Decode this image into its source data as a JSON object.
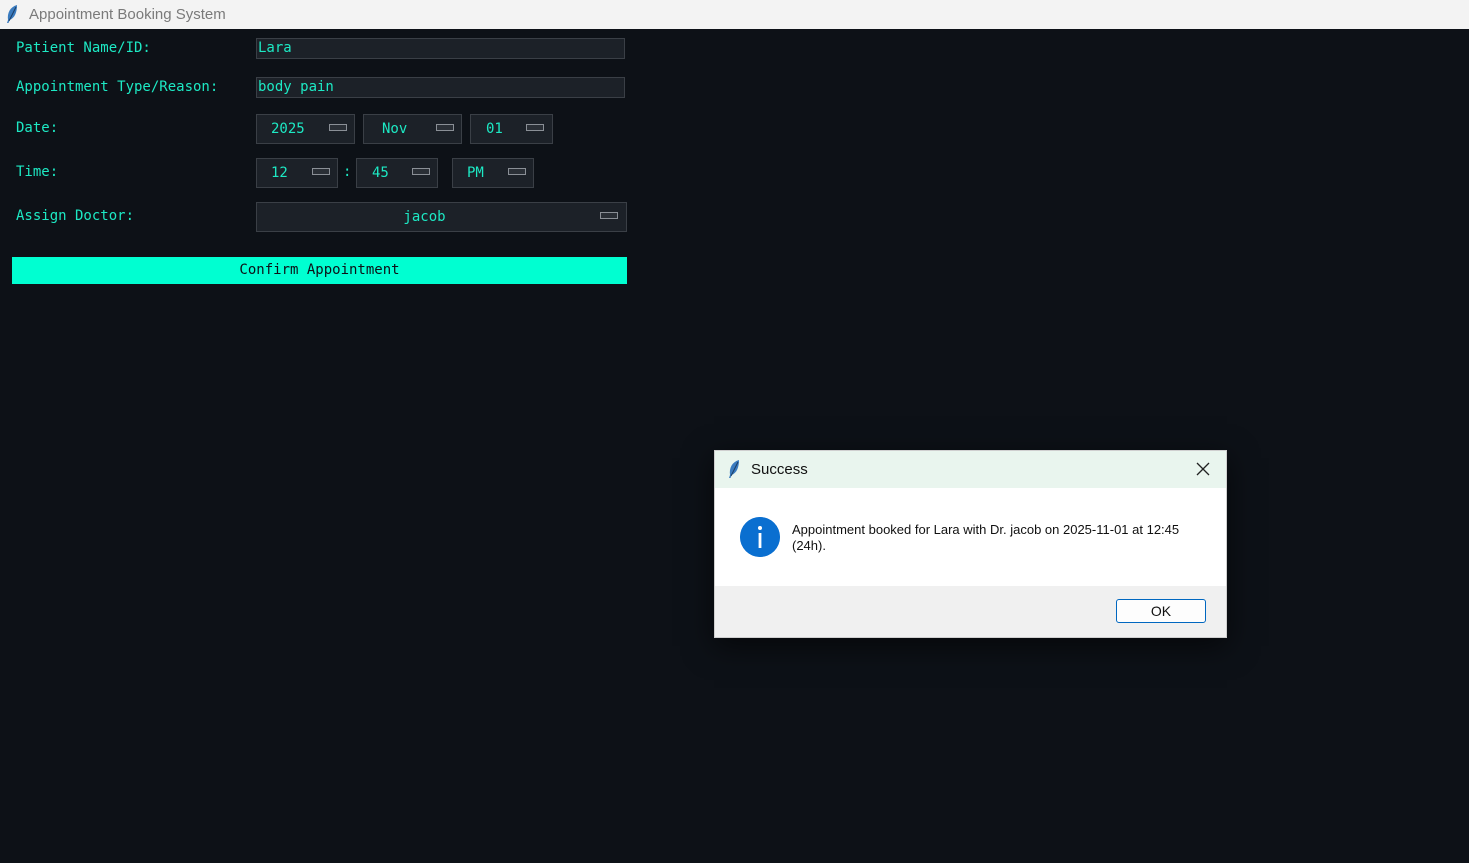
{
  "window": {
    "title": "Appointment Booking System",
    "icon": "feather-icon"
  },
  "form": {
    "patient_label": "Patient Name/ID:",
    "patient_value": "Lara",
    "reason_label": "Appointment Type/Reason:",
    "reason_value": "body pain",
    "date_label": "Date:",
    "date_year": "2025",
    "date_month": "Nov",
    "date_day": "01",
    "time_label": "Time:",
    "time_hour": "12",
    "time_separator": ":",
    "time_minute": "45",
    "time_ampm": "PM",
    "doctor_label": "Assign Doctor:",
    "doctor_value": "jacob",
    "confirm_label": "Confirm Appointment"
  },
  "dialog": {
    "title": "Success",
    "icon": "info-icon",
    "message": "Appointment booked for Lara with Dr. jacob on 2025-11-01 at 12:45 (24h).",
    "ok_label": "OK"
  },
  "colors": {
    "background": "#0d1117",
    "accent": "#1de9c4",
    "button": "#00ffd1",
    "field": "#1c2128",
    "dialog_header": "#e9f5ee"
  }
}
